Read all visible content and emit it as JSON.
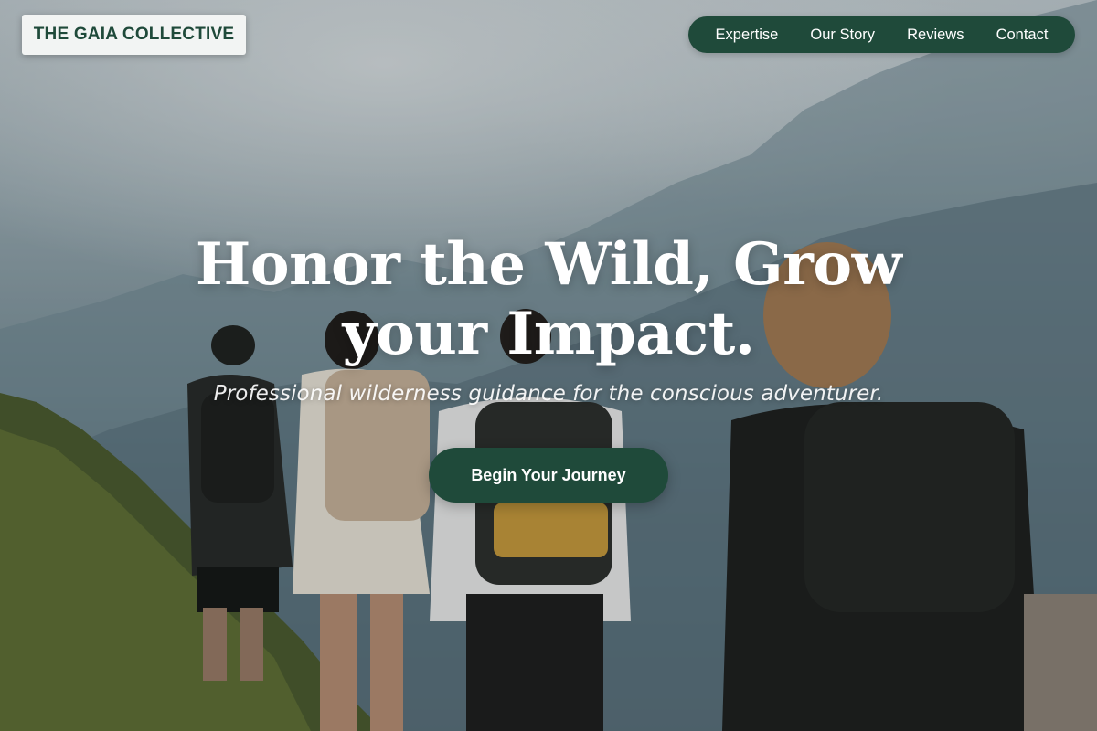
{
  "header": {
    "logo_text": "THE GAIA COLLECTIVE",
    "nav": [
      {
        "label": "Expertise"
      },
      {
        "label": "Our Story"
      },
      {
        "label": "Reviews"
      },
      {
        "label": "Contact"
      }
    ]
  },
  "hero": {
    "headline_line1": "Honor the Wild, Grow",
    "headline_line2": "your Impact.",
    "subtitle": "Professional wilderness guidance for the conscious adventurer.",
    "cta_label": "Begin Your Journey"
  },
  "colors": {
    "brand_green": "#1f4a3a",
    "logo_bg": "#f2f4f3",
    "text_light": "#ffffff"
  }
}
